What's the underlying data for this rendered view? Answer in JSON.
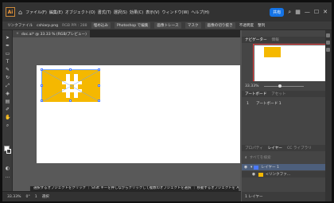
{
  "app": {
    "logo": "Ai",
    "home_icon": "home-icon"
  },
  "menu": [
    "ファイル(F)",
    "編集(E)",
    "オブジェクト(O)",
    "書式(T)",
    "選択(S)",
    "効果(C)",
    "表示(V)",
    "ウィンドウ(W)",
    "ヘルプ(H)"
  ],
  "header": {
    "share": "共有"
  },
  "control": {
    "items": [
      "リンクファイル",
      "cshiarp.png",
      "RGB PPI : 288",
      "埋め込み",
      "Photoshop で編集",
      "画像トレース",
      "マスク",
      "画像の切り抜き",
      "不透明度",
      "整列"
    ]
  },
  "document": {
    "tab": "doc.ai* @ 33.33 % (RGB/プレビュー)"
  },
  "status": {
    "zoom": "33.33%",
    "angle": "0°",
    "page": "1",
    "mode": "選択"
  },
  "tooltip": "選択するオブジェクトをクリック ｜ Shift キーを押しながらクリックして複数のオブジェクトを選択 ｜ 移動するオブジェクトを Alt キーを押しながらドラッグ",
  "navigator": {
    "tabs": [
      "ナビゲーター",
      "情報"
    ],
    "zoom": "33.33%"
  },
  "artboards_panel": {
    "tabs": [
      "アートボード",
      "アセット"
    ],
    "items": [
      {
        "num": "1",
        "name": "アートボード 1"
      }
    ]
  },
  "layers_panel": {
    "tabs": [
      "プロパティ",
      "レイヤー",
      "CC ライブラリ"
    ],
    "search_placeholder": "すべてを検索",
    "layers": [
      {
        "name": "レイヤー 1",
        "color": "#4b79ff"
      },
      {
        "name": "<リンクファ...",
        "color": "#f5b800"
      }
    ],
    "footer": "1 レイヤー"
  },
  "colors": {
    "accent": "#1473e6",
    "artwork": "#f5b800",
    "selection": "#4b79ff"
  }
}
